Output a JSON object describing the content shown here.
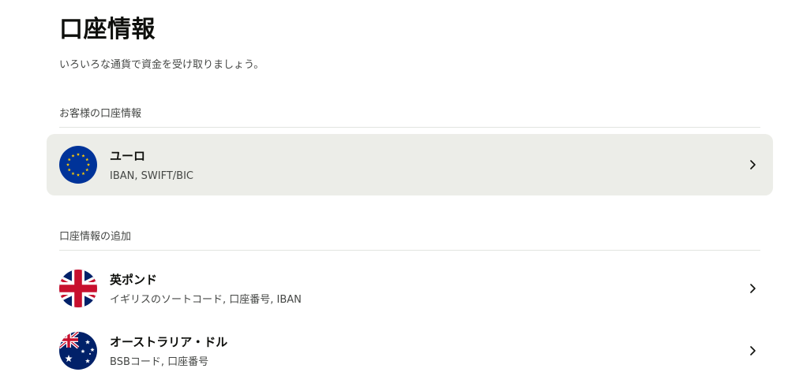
{
  "page": {
    "title": "口座情報",
    "subtitle": "いろいろな通貨で資金を受け取りましょう。"
  },
  "sections": [
    {
      "header": "お客様の口座情報",
      "items": [
        {
          "title": "ユーロ",
          "subtitle": "IBAN, SWIFT/BIC",
          "flag_icon": "eu-flag-icon",
          "selected": true
        }
      ]
    },
    {
      "header": "口座情報の追加",
      "items": [
        {
          "title": "英ポンド",
          "subtitle": "イギリスのソートコード, 口座番号, IBAN",
          "flag_icon": "uk-flag-icon",
          "selected": false
        },
        {
          "title": "オーストラリア・ドル",
          "subtitle": "BSBコード, 口座番号",
          "flag_icon": "australia-flag-icon",
          "selected": false
        }
      ]
    }
  ],
  "colors": {
    "text_primary": "#0e0f0c",
    "text_secondary": "#454745",
    "selected_row_bg": "#ecede8",
    "divider": "#e2e4e0",
    "eu_blue": "#003399",
    "eu_gold": "#ffcc00",
    "uk_blue": "#012169",
    "uk_red": "#c8102e"
  }
}
